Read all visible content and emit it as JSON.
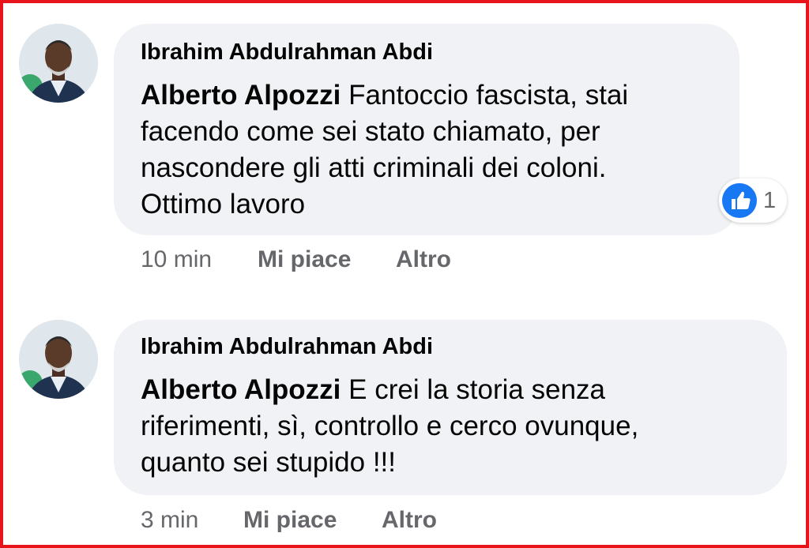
{
  "colors": {
    "frame": "#e8141b",
    "bubble": "#f0f2f5",
    "text": "#050505",
    "meta": "#65676b",
    "like_blue": "#1877f2"
  },
  "comments": [
    {
      "author": "Ibrahim Abdulrahman Abdi",
      "mention": "Alberto Alpozzi",
      "text_lines": [
        "Fantoccio fascista, stai",
        "facendo come sei stato chiamato, per",
        "nascondere gli atti criminali dei coloni.",
        "Ottimo lavoro"
      ],
      "time": "10 min",
      "like_label": "Mi piace",
      "more_label": "Altro",
      "reaction_icon": "thumbs-up-icon",
      "reaction_count": "1"
    },
    {
      "author": "Ibrahim Abdulrahman Abdi",
      "mention": "Alberto Alpozzi",
      "text_lines": [
        "E crei la storia senza",
        "riferimenti, sì, controllo e cerco ovunque,",
        "quanto sei stupido !!!"
      ],
      "time": "3 min",
      "like_label": "Mi piace",
      "more_label": "Altro"
    }
  ]
}
